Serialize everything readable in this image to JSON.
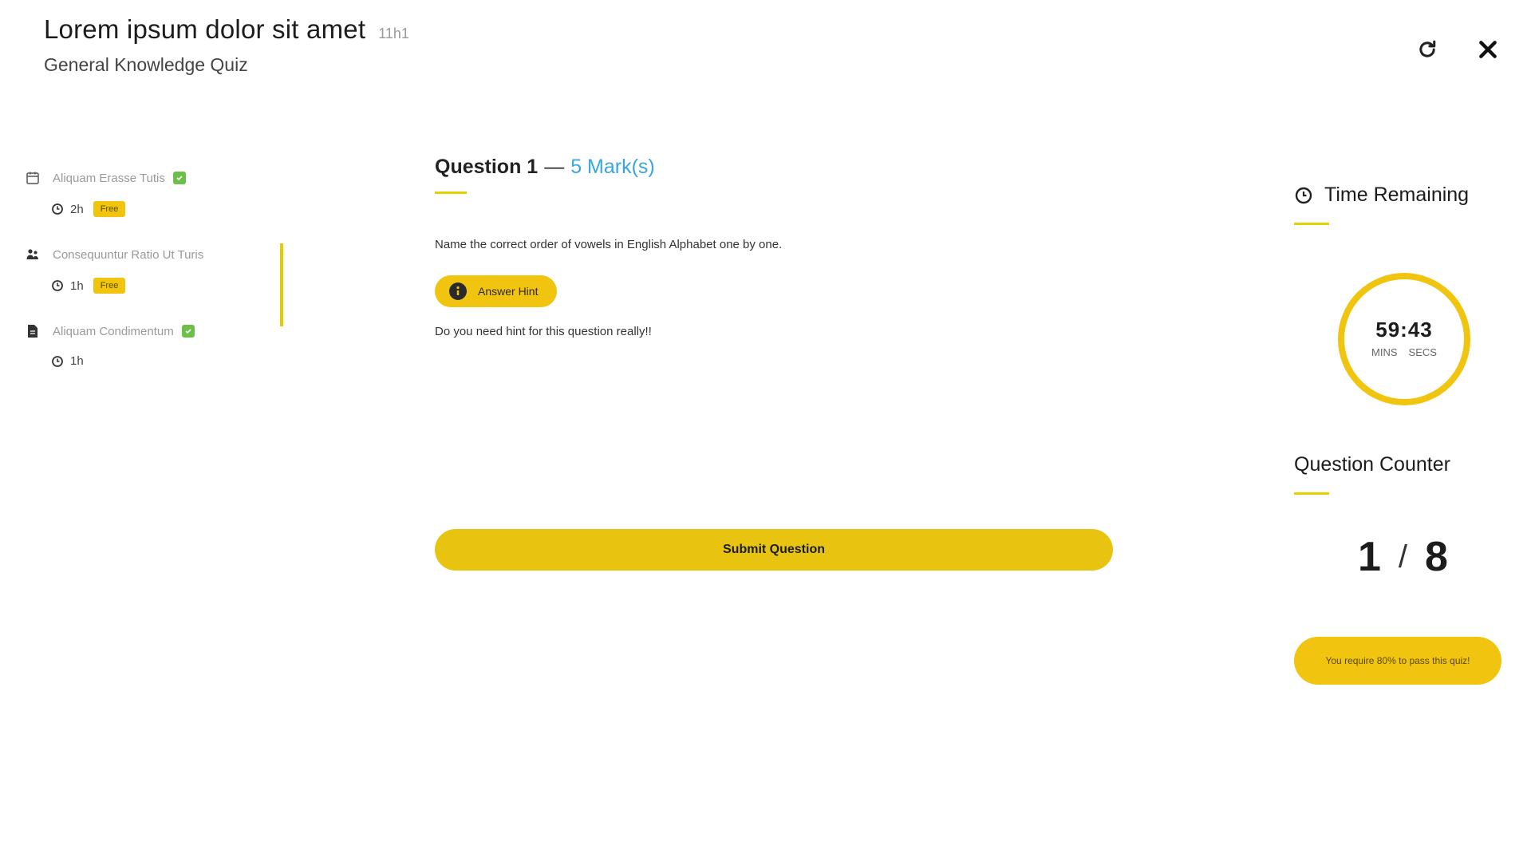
{
  "header": {
    "title": "Lorem ipsum dolor sit amet",
    "duration": "11h1",
    "subtitle": "General Knowledge Quiz"
  },
  "sidebar": {
    "items": [
      {
        "title": "Aliquam Erasse Tutis",
        "time": "2h",
        "badge": "Free",
        "type_icon": "calendar-icon",
        "completed": true
      },
      {
        "title": "Consequuntur Ratio Ut Turis",
        "time": "1h",
        "badge": "Free",
        "type_icon": "people-icon",
        "completed": false
      },
      {
        "title": "Aliquam Condimentum",
        "time": "1h",
        "badge": "",
        "type_icon": "document-icon",
        "completed": true
      }
    ]
  },
  "question": {
    "label": "Question 1",
    "dash": "—",
    "marks": "5 Mark(s)",
    "text": "Name the correct order of vowels in English Alphabet one by one.",
    "hint_label": "Answer Hint",
    "hint_text": "Do you need hint for this question really!!",
    "submit_label": "Submit Question"
  },
  "timer": {
    "title": "Time Remaining",
    "value": "59:43",
    "min_label": "MINS",
    "sec_label": "SECS"
  },
  "counter": {
    "title": "Question Counter",
    "current": "1",
    "separator": "/",
    "total": "8",
    "pass_label": "You require 80% to pass this quiz!"
  },
  "colors": {
    "accent": "#f1c40f",
    "marks": "#3aa6e0",
    "check": "#6cc04a"
  }
}
